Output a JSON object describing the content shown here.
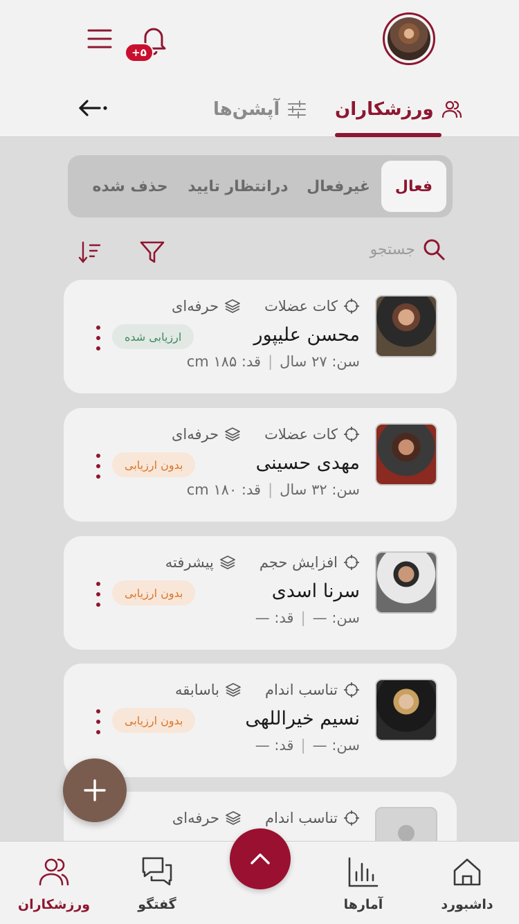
{
  "header": {
    "notification_count": "+۵",
    "tabs": [
      {
        "label": "ورزشکاران",
        "icon": "users-icon",
        "active": true
      },
      {
        "label": "آپشن‌ها",
        "icon": "sliders-icon",
        "active": false
      }
    ]
  },
  "status_filter": {
    "segments": [
      "فعال",
      "غیرفعال",
      "درانتظار تایید",
      "حذف شده"
    ],
    "selected": "فعال"
  },
  "search": {
    "placeholder": "جستجو"
  },
  "athletes": [
    {
      "goal": "کات عضلات",
      "level": "حرفه‌ای",
      "name": "محسن علیپور",
      "age_label": "سن:",
      "age": "۲۷ سال",
      "height_label": "قد:",
      "height": "۱۸۵ cm",
      "status": "ارزیابی شده",
      "status_color": "green"
    },
    {
      "goal": "کات عضلات",
      "level": "حرفه‌ای",
      "name": "مهدی حسینی",
      "age_label": "سن:",
      "age": "۳۲ سال",
      "height_label": "قد:",
      "height": "۱۸۰ cm",
      "status": "بدون ارزیابی",
      "status_color": "orange"
    },
    {
      "goal": "افزایش حجم",
      "level": "پیشرفته",
      "name": "سرنا اسدی",
      "age_label": "سن:",
      "age": "—",
      "height_label": "قد:",
      "height": "—",
      "status": "بدون ارزیابی",
      "status_color": "orange"
    },
    {
      "goal": "تناسب اندام",
      "level": "باسابقه",
      "name": "نسیم خیراللهی",
      "age_label": "سن:",
      "age": "—",
      "height_label": "قد:",
      "height": "—",
      "status": "بدون ارزیابی",
      "status_color": "orange"
    },
    {
      "goal": "تناسب اندام",
      "level": "حرفه‌ای"
    }
  ],
  "bottom_nav": [
    {
      "label": "داشبورد",
      "icon": "home-icon"
    },
    {
      "label": "آمارها",
      "icon": "bar-chart-icon"
    },
    {
      "label": "گفتگو",
      "icon": "chat-icon"
    },
    {
      "label": "ورزشکاران",
      "icon": "users-icon",
      "active": true
    }
  ],
  "colors": {
    "brand": "#8e1630",
    "badge_green_text": "#3e8a5e",
    "badge_orange_text": "#d9772a",
    "fab": "#7a5c4e"
  }
}
